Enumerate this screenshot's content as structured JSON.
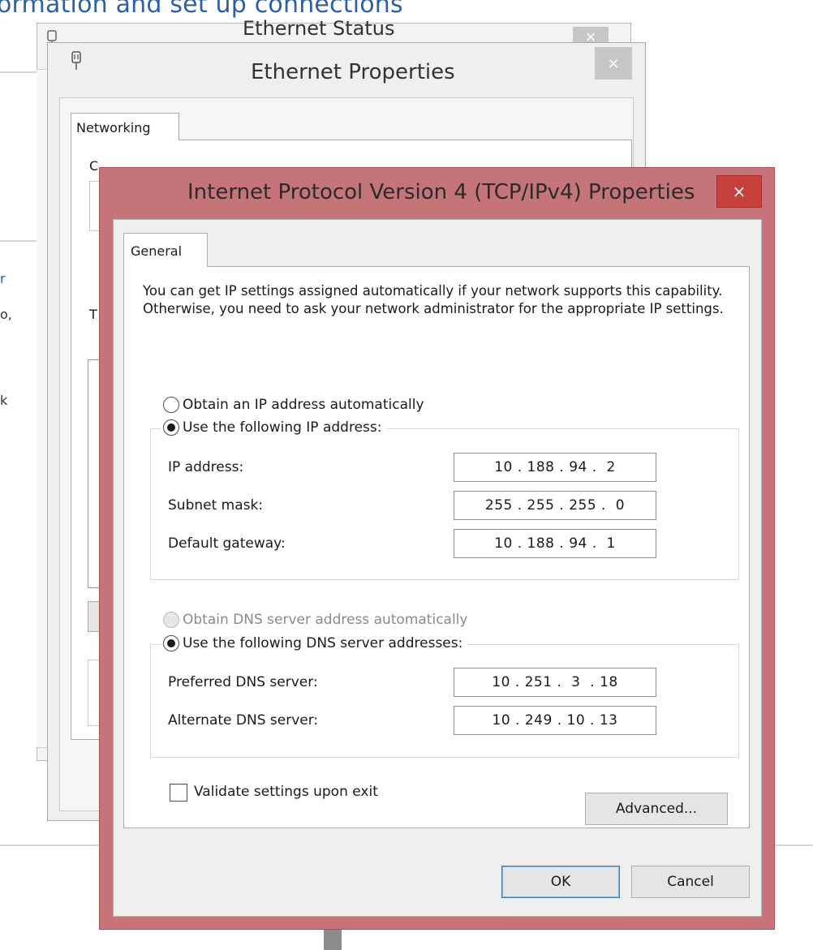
{
  "background": {
    "heading": "ormation and set up connections",
    "side_letters": [
      "r",
      "o,",
      "k"
    ],
    "ethernet_letters": [
      "C",
      "T"
    ]
  },
  "windows": {
    "status": {
      "title": "Ethernet Status",
      "close": "×"
    },
    "ethernet": {
      "title": "Ethernet Properties",
      "close": "×",
      "tab": "Networking"
    },
    "ipv4": {
      "title": "Internet Protocol Version 4 (TCP/IPv4) Properties",
      "close": "×",
      "tab": "General",
      "intro": "You can get IP settings assigned automatically if your network supports this capability. Otherwise, you need to ask your network administrator for the appropriate IP settings.",
      "ip_auto": "Obtain an IP address automatically",
      "ip_manual": "Use the following IP address:",
      "ip_address_label": "IP address:",
      "ip_address": "10 . 188 . 94 .  2",
      "subnet_label": "Subnet mask:",
      "subnet": "255 . 255 . 255 .  0",
      "gateway_label": "Default gateway:",
      "gateway": "10 . 188 . 94 .  1",
      "dns_auto": "Obtain DNS server address automatically",
      "dns_manual": "Use the following DNS server addresses:",
      "preferred_label": "Preferred DNS server:",
      "preferred": "10 . 251 .  3  . 18",
      "alternate_label": "Alternate DNS server:",
      "alternate": "10 . 249 . 10 . 13",
      "validate": "Validate settings upon exit",
      "advanced": "Advanced...",
      "ok": "OK",
      "cancel": "Cancel"
    }
  },
  "colors": {
    "dialog_frame": "#c5757a",
    "close_button": "#c7403e",
    "link_blue": "#2c5fa3"
  }
}
